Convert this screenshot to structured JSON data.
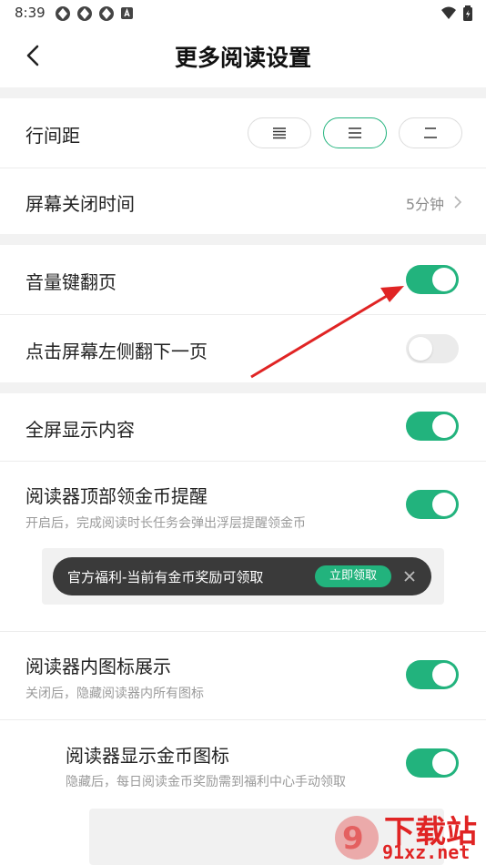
{
  "status_bar": {
    "time": "8:39"
  },
  "header": {
    "title": "更多阅读设置"
  },
  "settings": {
    "line_spacing": {
      "label": "行间距",
      "selected_option": 2
    },
    "screen_off": {
      "label": "屏幕关闭时间",
      "value": "5分钟"
    },
    "volume_key_flip": {
      "label": "音量键翻页",
      "enabled": true
    },
    "tap_left_flip": {
      "label": "点击屏幕左侧翻下一页",
      "enabled": false
    },
    "fullscreen": {
      "label": "全屏显示内容",
      "enabled": true
    },
    "coin_reminder": {
      "label": "阅读器顶部领金币提醒",
      "description": "开启后，完成阅读时长任务会弹出浮层提醒领金币",
      "enabled": true,
      "preview": {
        "text": "官方福利-当前有金币奖励可领取",
        "button": "立即领取"
      }
    },
    "reader_icons": {
      "label": "阅读器内图标展示",
      "description": "关闭后，隐藏阅读器内所有图标",
      "enabled": true
    },
    "coin_icon": {
      "label": "阅读器显示金币图标",
      "description": "隐藏后，每日阅读金币奖励需到福利中心手动领取",
      "enabled": true
    }
  },
  "watermark": {
    "brand": "下载站",
    "url": "91xz.net"
  },
  "colors": {
    "accent": "#22b37d",
    "annotation_arrow": "#e02424"
  }
}
